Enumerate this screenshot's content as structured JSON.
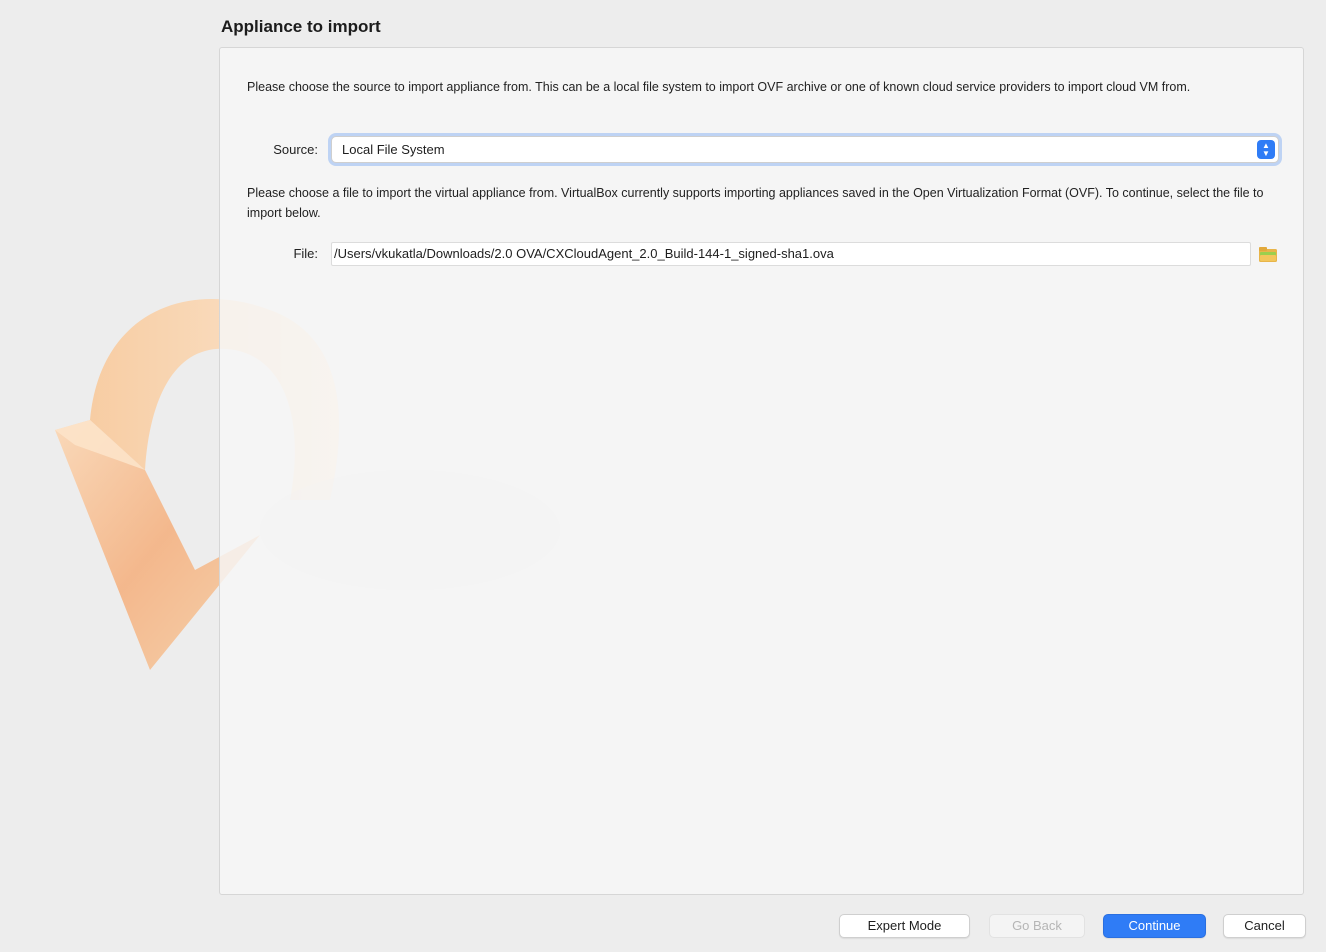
{
  "page": {
    "title": "Appliance to import"
  },
  "source_section": {
    "description": "Please choose the source to import appliance from. This can be a local file system to import OVF archive or one of known cloud service providers to import cloud VM from.",
    "label": "Source:",
    "selected": "Local File System"
  },
  "file_section": {
    "description": "Please choose a file to import the virtual appliance from. VirtualBox currently supports importing appliances saved in the Open Virtualization Format (OVF). To continue, select the file to import below.",
    "label": "File:",
    "value": "/Users/vkukatla/Downloads/2.0 OVA/CXCloudAgent_2.0_Build-144-1_signed-sha1.ova"
  },
  "buttons": {
    "expert_mode": "Expert Mode",
    "go_back": "Go Back",
    "continue": "Continue",
    "cancel": "Cancel"
  },
  "icons": {
    "select_stepper": "chevron-up-down-icon",
    "file_picker": "folder-icon",
    "logo": "virtualbox-import-arrow-logo"
  },
  "colors": {
    "accent": "#2f7cf6",
    "logo_orange": "#f2b07a"
  }
}
